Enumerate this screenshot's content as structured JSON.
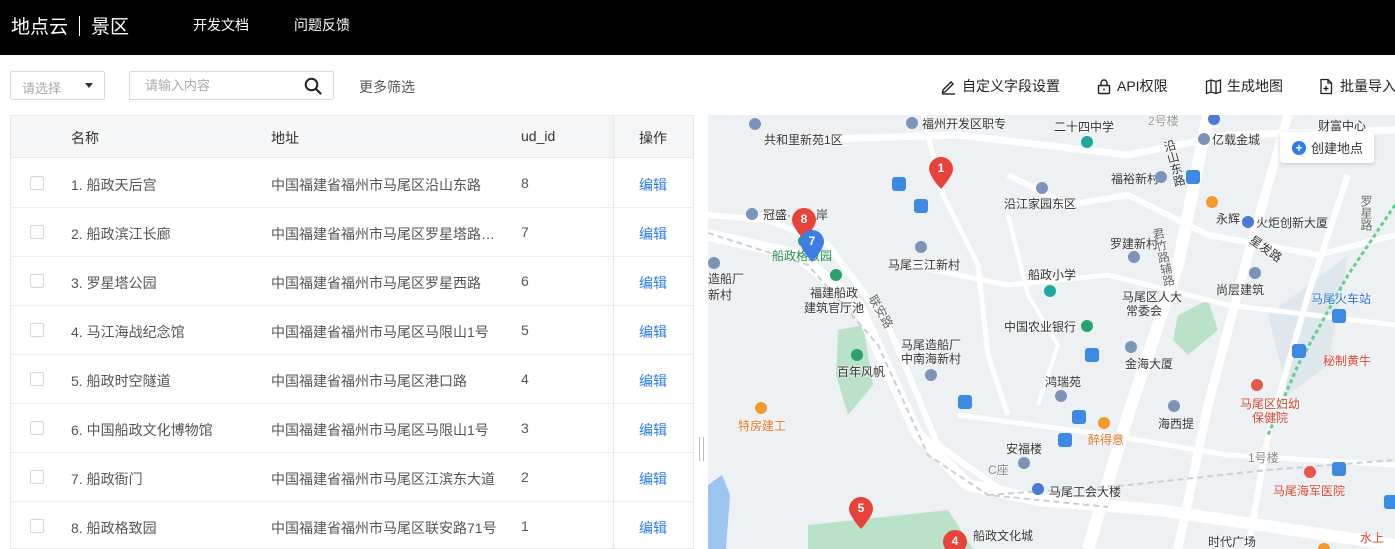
{
  "header": {
    "brand_left": "地点云",
    "brand_right": "景区",
    "nav": [
      "开发文档",
      "问题反馈"
    ]
  },
  "toolbar": {
    "select_placeholder": "请选择",
    "search_placeholder": "请输入内容",
    "more_filter": "更多筛选",
    "actions": [
      {
        "label": "自定义字段设置",
        "icon": "pen-icon"
      },
      {
        "label": "API权限",
        "icon": "lock-icon"
      },
      {
        "label": "生成地图",
        "icon": "map-icon"
      },
      {
        "label": "批量导入",
        "icon": "file-import-icon"
      }
    ]
  },
  "table": {
    "columns": [
      "名称",
      "地址",
      "ud_id",
      "操作"
    ],
    "rows": [
      {
        "name": "1. 船政天后宫",
        "address": "中国福建省福州市马尾区沿山东路",
        "ud_id": "8",
        "action": "编辑"
      },
      {
        "name": "2. 船政滨江长廊",
        "address": "中国福建省福州市马尾区罗星塔路…",
        "ud_id": "7",
        "action": "编辑"
      },
      {
        "name": "3. 罗星塔公园",
        "address": "中国福建省福州市马尾区罗星西路",
        "ud_id": "6",
        "action": "编辑"
      },
      {
        "name": "4. 马江海战纪念馆",
        "address": "中国福建省福州市马尾区马限山1号",
        "ud_id": "5",
        "action": "编辑"
      },
      {
        "name": "5. 船政时空隧道",
        "address": "中国福建省福州市马尾区港口路",
        "ud_id": "4",
        "action": "编辑"
      },
      {
        "name": "6. 中国船政文化博物馆",
        "address": "中国福建省福州市马尾区马限山1号",
        "ud_id": "3",
        "action": "编辑"
      },
      {
        "name": "7. 船政衙门",
        "address": "中国福建省福州市马尾区江滨东大道",
        "ud_id": "2",
        "action": "编辑"
      },
      {
        "name": "8. 船政格致园",
        "address": "中国福建省福州市马尾区联安路71号",
        "ud_id": "1",
        "action": "编辑"
      }
    ]
  },
  "map": {
    "create_button": "创建地点",
    "markers": [
      "1",
      "8",
      "7",
      "5",
      "4"
    ],
    "labels": {
      "l1": "共和里新苑1区",
      "l2": "福州开发区职专",
      "l3": "二十四中学",
      "l4": "2号楼",
      "l5": "亿载金城",
      "l6": "财富中心",
      "l7": "沿山东路",
      "l8": "福裕新村",
      "l9": "沿江家园东区",
      "l10": "冠盛·",
      "l11": "岸",
      "l12": "永辉",
      "l13": "火炬创新大厦",
      "l14": "船政格致园",
      "l15": "罗建新村",
      "l16": "星发路",
      "l17": "马尾三江新村",
      "l18": "造船厂",
      "l19": "新村",
      "l20": "福建船政",
      "l21": "建筑官厅池",
      "l22": "船政小学",
      "l23": "尚层建筑",
      "l24": "马尾火车站",
      "l25": "马尾区人大",
      "l26": "常委会",
      "l27": "中国农业银行",
      "l28": "马尾造船厂",
      "l29": "中南海新村",
      "l30": "金海大厦",
      "l31": "秘制黄牛",
      "l32": "百年风帆",
      "l33": "鸿瑞苑",
      "l34": "马尾区妇幼",
      "l35": "保健院",
      "l36": "特房建工",
      "l37": "醉得意",
      "l38": "海西提",
      "l39": "安福楼",
      "l40": "1号楼",
      "l41": "马尾海军医院",
      "l42": "C座",
      "l43": "马尾工会大楼",
      "l44": "船政文化城",
      "l45": "时代广场",
      "l46": "水上",
      "l47": "联安路",
      "l48": "君竹路辅路",
      "l49": "罗星路"
    },
    "colors": {
      "marker_red": "#e8433a",
      "marker_blue": "#3d7ee6",
      "water": "#9ec4f0",
      "park": "#b9e2c8",
      "road": "#ffffff"
    }
  }
}
